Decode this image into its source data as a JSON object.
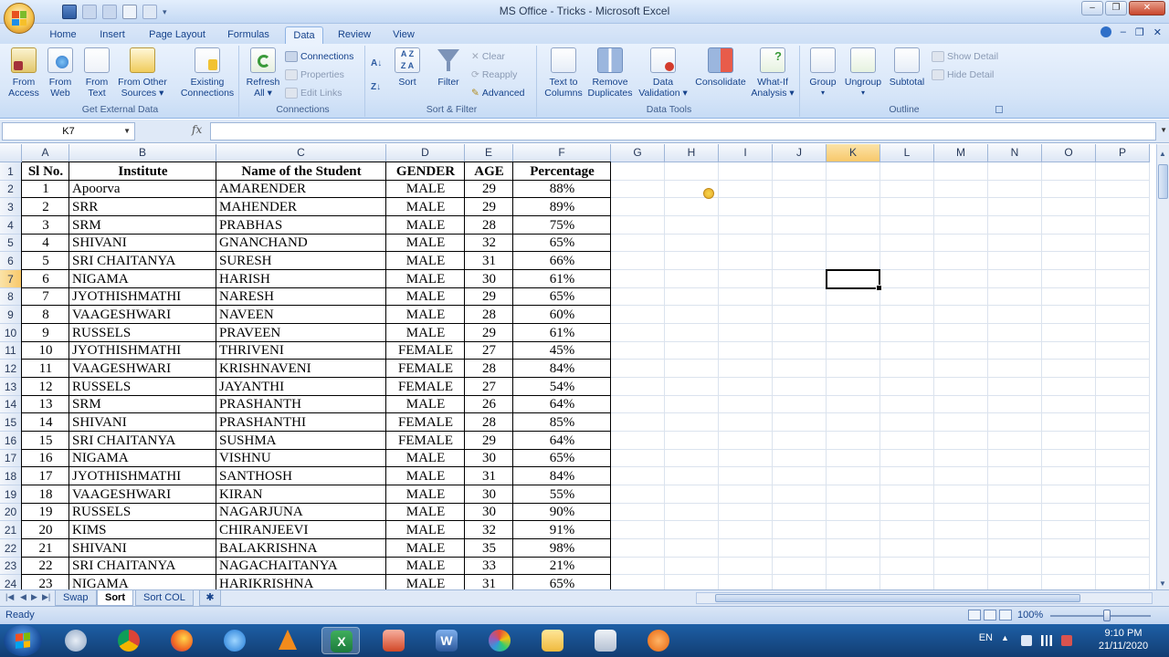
{
  "window": {
    "title": "MS Office - Tricks - Microsoft Excel"
  },
  "tabs": [
    "Home",
    "Insert",
    "Page Layout",
    "Formulas",
    "Data",
    "Review",
    "View"
  ],
  "active_tab": "Data",
  "ribbon": {
    "get_external_data": {
      "label": "Get External Data",
      "from_access": [
        "From",
        "Access"
      ],
      "from_web": [
        "From",
        "Web"
      ],
      "from_text": [
        "From",
        "Text"
      ],
      "from_other": [
        "From Other",
        "Sources ▾"
      ],
      "existing": [
        "Existing",
        "Connections"
      ]
    },
    "connections": {
      "label": "Connections",
      "refresh": [
        "Refresh",
        "All ▾"
      ],
      "connections": "Connections",
      "properties": "Properties",
      "edit_links": "Edit Links"
    },
    "sort_filter": {
      "label": "Sort & Filter",
      "sort": "Sort",
      "filter": "Filter",
      "clear": "Clear",
      "reapply": "Reapply",
      "advanced": "Advanced"
    },
    "data_tools": {
      "label": "Data Tools",
      "text_to_columns": [
        "Text to",
        "Columns"
      ],
      "remove_duplicates": [
        "Remove",
        "Duplicates"
      ],
      "data_validation": [
        "Data",
        "Validation ▾"
      ],
      "consolidate": "Consolidate",
      "what_if": [
        "What-If",
        "Analysis ▾"
      ]
    },
    "outline": {
      "label": "Outline",
      "group": "Group",
      "ungroup": "Ungroup",
      "subtotal": "Subtotal",
      "show_detail": "Show Detail",
      "hide_detail": "Hide Detail"
    }
  },
  "formula_bar": {
    "name_box": "K7",
    "fx": "fx",
    "formula": ""
  },
  "columns": [
    "A",
    "B",
    "C",
    "D",
    "E",
    "F",
    "G",
    "H",
    "I",
    "J",
    "K",
    "L",
    "M",
    "N",
    "O",
    "P"
  ],
  "selected_column": "K",
  "selected_row": 7,
  "table": {
    "headers": [
      "Sl No.",
      "Institute",
      "Name of the Student",
      "GENDER",
      "AGE",
      "Percentage"
    ],
    "rows": [
      [
        "1",
        "Apoorva",
        "AMARENDER",
        "MALE",
        "29",
        "88%"
      ],
      [
        "2",
        "SRR",
        "MAHENDER",
        "MALE",
        "29",
        "89%"
      ],
      [
        "3",
        "SRM",
        "PRABHAS",
        "MALE",
        "28",
        "75%"
      ],
      [
        "4",
        "SHIVANI",
        "GNANCHAND",
        "MALE",
        "32",
        "65%"
      ],
      [
        "5",
        "SRI CHAITANYA",
        "SURESH",
        "MALE",
        "31",
        "66%"
      ],
      [
        "6",
        "NIGAMA",
        "HARISH",
        "MALE",
        "30",
        "61%"
      ],
      [
        "7",
        "JYOTHISHMATHI",
        "NARESH",
        "MALE",
        "29",
        "65%"
      ],
      [
        "8",
        "VAAGESHWARI",
        "NAVEEN",
        "MALE",
        "28",
        "60%"
      ],
      [
        "9",
        "RUSSELS",
        "PRAVEEN",
        "MALE",
        "29",
        "61%"
      ],
      [
        "10",
        "JYOTHISHMATHI",
        "THRIVENI",
        "FEMALE",
        "27",
        "45%"
      ],
      [
        "11",
        "VAAGESHWARI",
        "KRISHNAVENI",
        "FEMALE",
        "28",
        "84%"
      ],
      [
        "12",
        "RUSSELS",
        "JAYANTHI",
        "FEMALE",
        "27",
        "54%"
      ],
      [
        "13",
        "SRM",
        "PRASHANTH",
        "MALE",
        "26",
        "64%"
      ],
      [
        "14",
        "SHIVANI",
        "PRASHANTHI",
        "FEMALE",
        "28",
        "85%"
      ],
      [
        "15",
        "SRI CHAITANYA",
        "SUSHMA",
        "FEMALE",
        "29",
        "64%"
      ],
      [
        "16",
        "NIGAMA",
        "VISHNU",
        "MALE",
        "30",
        "65%"
      ],
      [
        "17",
        "JYOTHISHMATHI",
        "SANTHOSH",
        "MALE",
        "31",
        "84%"
      ],
      [
        "18",
        "VAAGESHWARI",
        "KIRAN",
        "MALE",
        "30",
        "55%"
      ],
      [
        "19",
        "RUSSELS",
        "NAGARJUNA",
        "MALE",
        "30",
        "90%"
      ],
      [
        "20",
        "KIMS",
        "CHIRANJEEVI",
        "MALE",
        "32",
        "91%"
      ],
      [
        "21",
        "SHIVANI",
        "BALAKRISHNA",
        "MALE",
        "35",
        "98%"
      ],
      [
        "22",
        "SRI CHAITANYA",
        "NAGACHAITANYA",
        "MALE",
        "33",
        "21%"
      ],
      [
        "23",
        "NIGAMA",
        "HARIKRISHNA",
        "MALE",
        "31",
        "65%"
      ]
    ]
  },
  "sheets": [
    "Swap",
    "Sort",
    "Sort COL"
  ],
  "active_sheet": "Sort",
  "status": {
    "text": "Ready",
    "zoom": "100%"
  },
  "taskbar": {
    "lang": "EN",
    "time": "9:10 PM",
    "date": "21/11/2020"
  },
  "colors": {
    "accent": "#15428b",
    "ribbon": "#d6e5f8",
    "selected_header": "#f8c86a",
    "taskbar": "#1d5fa6"
  }
}
